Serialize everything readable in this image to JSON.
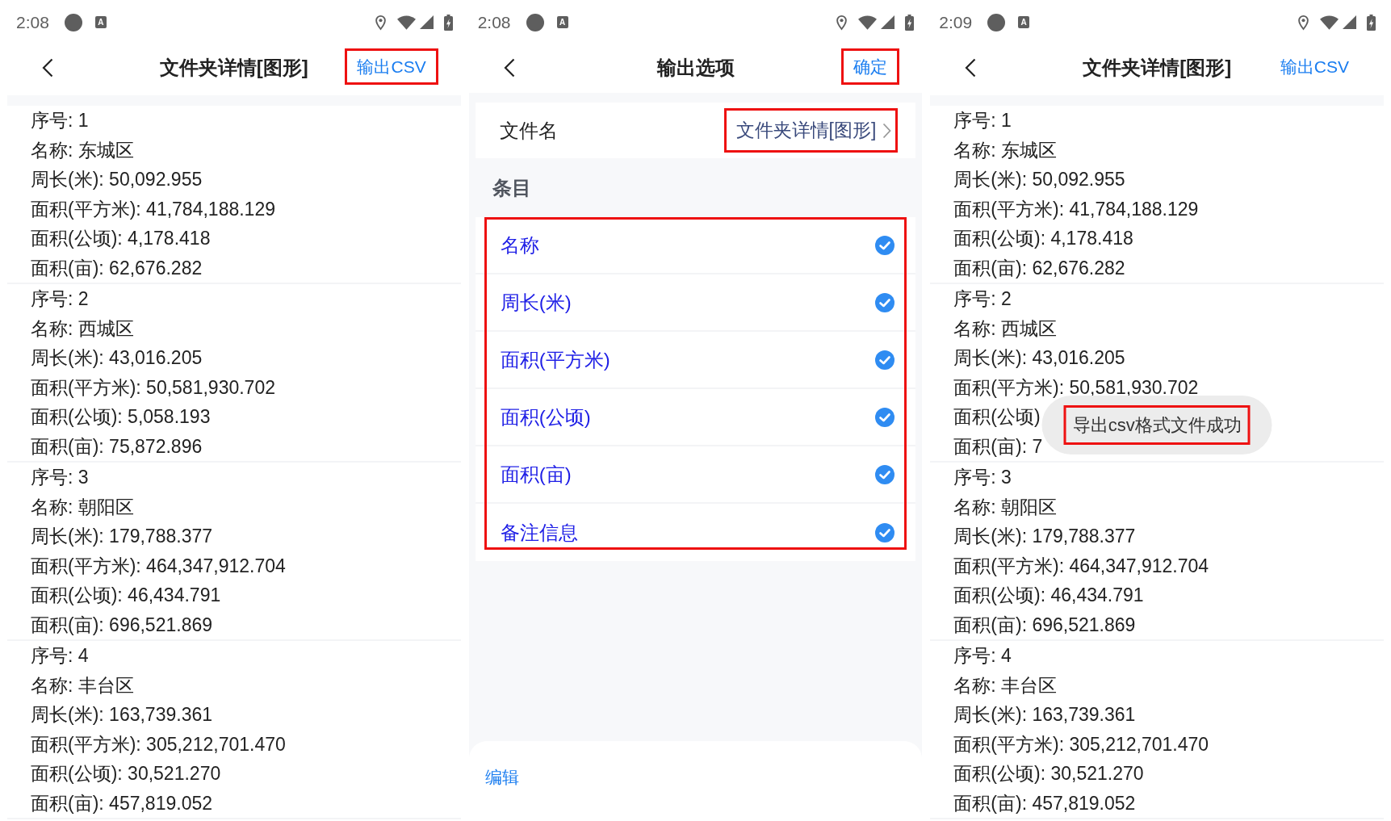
{
  "screens": [
    {
      "kind": "details",
      "status_bar": {
        "time": "2:08",
        "badge": "A"
      },
      "header": {
        "title": "文件夹详情[图形]",
        "action": {
          "label": "输出CSV",
          "highlighted": true
        }
      },
      "records": [
        {
          "lines": [
            "序号: 1",
            "名称: 东城区",
            "周长(米): 50,092.955",
            "面积(平方米): 41,784,188.129",
            "面积(公顷): 4,178.418",
            "面积(亩): 62,676.282"
          ]
        },
        {
          "lines": [
            "序号: 2",
            "名称: 西城区",
            "周长(米): 43,016.205",
            "面积(平方米): 50,581,930.702",
            "面积(公顷): 5,058.193",
            "面积(亩): 75,872.896"
          ]
        },
        {
          "lines": [
            "序号: 3",
            "名称: 朝阳区",
            "周长(米): 179,788.377",
            "面积(平方米): 464,347,912.704",
            "面积(公顷): 46,434.791",
            "面积(亩): 696,521.869"
          ]
        },
        {
          "lines": [
            "序号: 4",
            "名称: 丰台区",
            "周长(米): 163,739.361",
            "面积(平方米): 305,212,701.470",
            "面积(公顷): 30,521.270",
            "面积(亩): 457,819.052"
          ]
        }
      ]
    },
    {
      "kind": "options",
      "status_bar": {
        "time": "2:08",
        "badge": "A"
      },
      "header": {
        "title": "输出选项",
        "action": {
          "label": "确定",
          "highlighted": true
        }
      },
      "file_name": {
        "label": "文件名",
        "value": "文件夹详情[图形]",
        "highlighted": true
      },
      "section_title": "条目",
      "items_highlighted": true,
      "items": [
        {
          "label": "名称",
          "checked": true
        },
        {
          "label": "周长(米)",
          "checked": true
        },
        {
          "label": "面积(平方米)",
          "checked": true
        },
        {
          "label": "面积(公顷)",
          "checked": true
        },
        {
          "label": "面积(亩)",
          "checked": true
        },
        {
          "label": "备注信息",
          "checked": true
        }
      ],
      "footer": {
        "action": "编辑"
      }
    },
    {
      "kind": "details",
      "status_bar": {
        "time": "2:09",
        "badge": "A"
      },
      "header": {
        "title": "文件夹详情[图形]",
        "action": {
          "label": "输出CSV",
          "highlighted": false
        }
      },
      "records": [
        {
          "lines": [
            "序号: 1",
            "名称: 东城区",
            "周长(米): 50,092.955",
            "面积(平方米): 41,784,188.129",
            "面积(公顷): 4,178.418",
            "面积(亩): 62,676.282"
          ]
        },
        {
          "lines": [
            "序号: 2",
            "名称: 西城区",
            "周长(米): 43,016.205",
            "面积(平方米): 50,581,930.702",
            "面积(公顷)",
            "面积(亩): 7"
          ]
        },
        {
          "lines": [
            "序号: 3",
            "名称: 朝阳区",
            "周长(米): 179,788.377",
            "面积(平方米): 464,347,912.704",
            "面积(公顷): 46,434.791",
            "面积(亩): 696,521.869"
          ]
        },
        {
          "lines": [
            "序号: 4",
            "名称: 丰台区",
            "周长(米): 163,739.361",
            "面积(平方米): 305,212,701.470",
            "面积(公顷): 30,521.270",
            "面积(亩): 457,819.052"
          ]
        }
      ],
      "toast": {
        "text": "导出csv格式文件成功",
        "highlighted": true
      }
    }
  ]
}
